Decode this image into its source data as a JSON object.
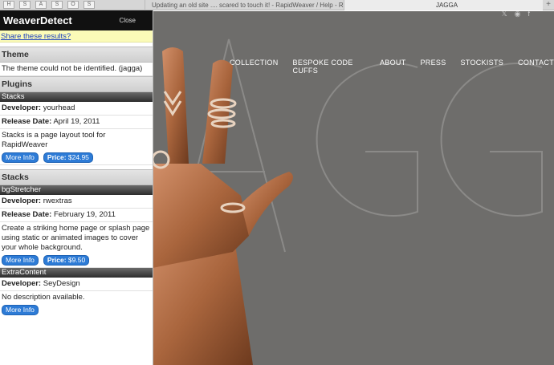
{
  "browser": {
    "pinned_tabs": [
      "H",
      "S",
      "A",
      "S",
      "O",
      "S"
    ],
    "tabs": [
      {
        "label": "Updating an old site .... scared to touch it! - RapidWeaver / Help - Rea..."
      },
      {
        "label": "JAGGA"
      }
    ],
    "add_tab": "+"
  },
  "panel": {
    "title": "WeaverDetect",
    "close": "Close",
    "share": "Share these results?",
    "theme": {
      "heading": "Theme",
      "text": "The theme could not be identified. (jagga)"
    },
    "plugins_heading": "Plugins",
    "stacks_plugin": {
      "name": "Stacks",
      "developer_label": "Developer:",
      "developer": "yourhead",
      "release_label": "Release Date:",
      "release": "April 19, 2011",
      "description": "Stacks is a page layout tool for RapidWeaver",
      "more_info": "More Info",
      "price_label": "Price:",
      "price": "$24.95"
    },
    "stacks_heading": "Stacks",
    "bgstretcher": {
      "name": "bgStretcher",
      "developer_label": "Developer:",
      "developer": "rwextras",
      "release_label": "Release Date:",
      "release": "February 19, 2011",
      "description": "Create a striking home page or splash page using static or animated images to cover your whole background.",
      "more_info": "More Info",
      "price_label": "Price:",
      "price": "$9.50"
    },
    "extracontent": {
      "name": "ExtraContent",
      "developer_label": "Developer:",
      "developer": "SeyDesign",
      "description": "No description available.",
      "more_info": "More Info"
    }
  },
  "site": {
    "nav": [
      "COLLECTION",
      "BESPOKE CODE CUFFS",
      "ABOUT",
      "PRESS",
      "STOCKISTS",
      "CONTACT"
    ],
    "social_icons": [
      "twitter-icon",
      "instagram-icon",
      "facebook-icon"
    ],
    "colors": {
      "background": "#6e6d6b",
      "logo": "#8a8987",
      "skin": "#b06a3e"
    }
  }
}
